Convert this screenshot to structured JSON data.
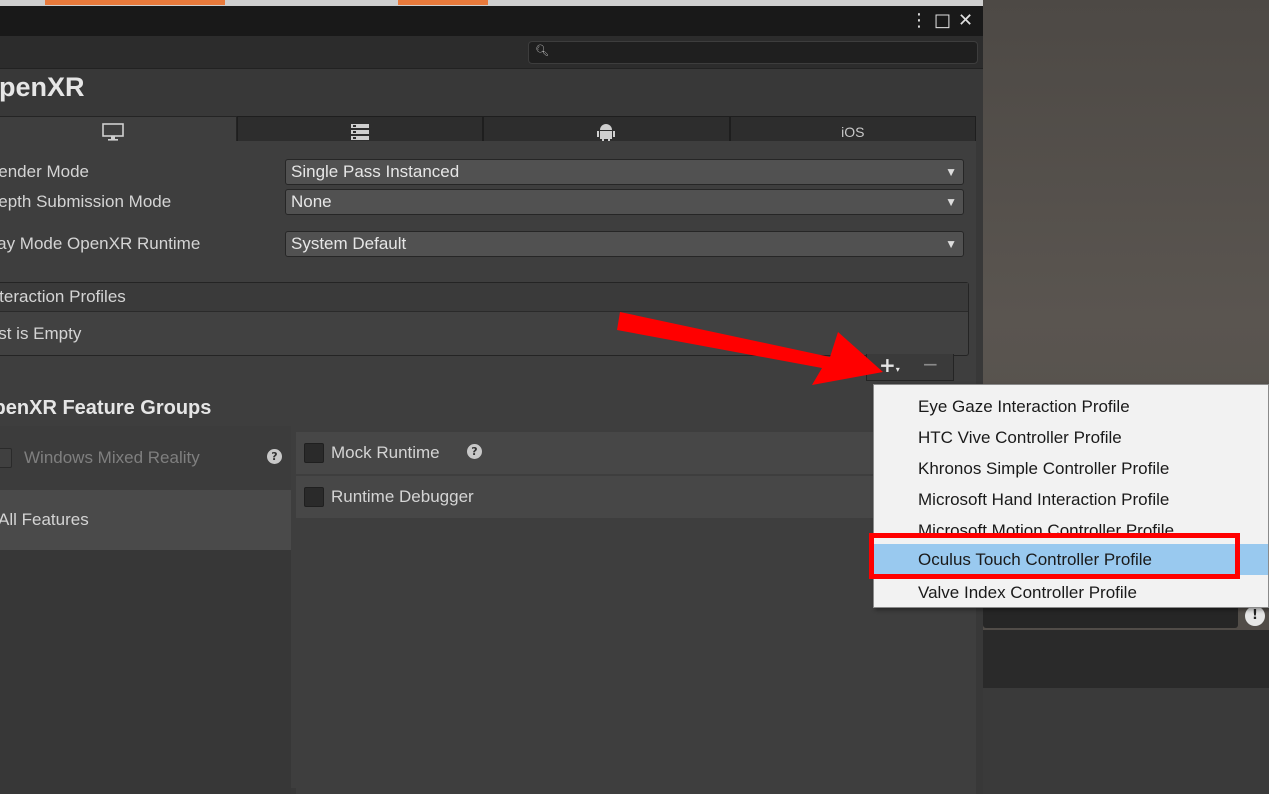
{
  "window": {
    "title_buttons": {
      "more_icon": "more-vertical-icon",
      "maximize_icon": "maximize-icon",
      "close_icon": "close-icon",
      "more_glyph": "⋮",
      "maximize_glyph": "□",
      "close_glyph": "✕"
    },
    "search": {
      "icon": "search-icon",
      "placeholder": "",
      "value": ""
    }
  },
  "section": {
    "title": "OpenXR"
  },
  "platform_tabs": [
    {
      "name": "standalone",
      "icon": "monitor-icon",
      "glyph": "🖥",
      "label": ""
    },
    {
      "name": "server",
      "icon": "server-icon",
      "glyph": "≣",
      "label": ""
    },
    {
      "name": "android",
      "icon": "android-icon",
      "glyph": "⬣",
      "label": ""
    },
    {
      "name": "ios",
      "icon": "",
      "glyph": "",
      "label": "iOS"
    }
  ],
  "settings": {
    "render_mode": {
      "label": "Render Mode",
      "value": "Single Pass Instanced"
    },
    "depth_mode": {
      "label": "Depth Submission Mode",
      "value": "None"
    },
    "play_mode": {
      "label": "Play Mode OpenXR Runtime",
      "value": "System Default"
    }
  },
  "interaction_profiles": {
    "header": "Interaction Profiles",
    "empty_text": "List is Empty",
    "add_glyph": "+",
    "remove_glyph": "−"
  },
  "feature_groups": {
    "title": "OpenXR Feature Groups",
    "groups": [
      {
        "label": "Windows Mixed Reality",
        "help": "?"
      },
      {
        "label": "All Features"
      }
    ],
    "features": [
      {
        "label": "Mock Runtime",
        "help": "?"
      },
      {
        "label": "Runtime Debugger"
      }
    ]
  },
  "add_menu": {
    "items": [
      "Eye Gaze Interaction Profile",
      "HTC Vive Controller Profile",
      "Khronos Simple Controller Profile",
      "Microsoft Hand Interaction Profile",
      "Microsoft Motion Controller Profile",
      "Oculus Touch Controller Profile",
      "Valve Index Controller Profile"
    ],
    "selected_index": 5
  },
  "colors": {
    "annotation_red": "#ff0000",
    "menu_selection": "#99c9ef"
  }
}
